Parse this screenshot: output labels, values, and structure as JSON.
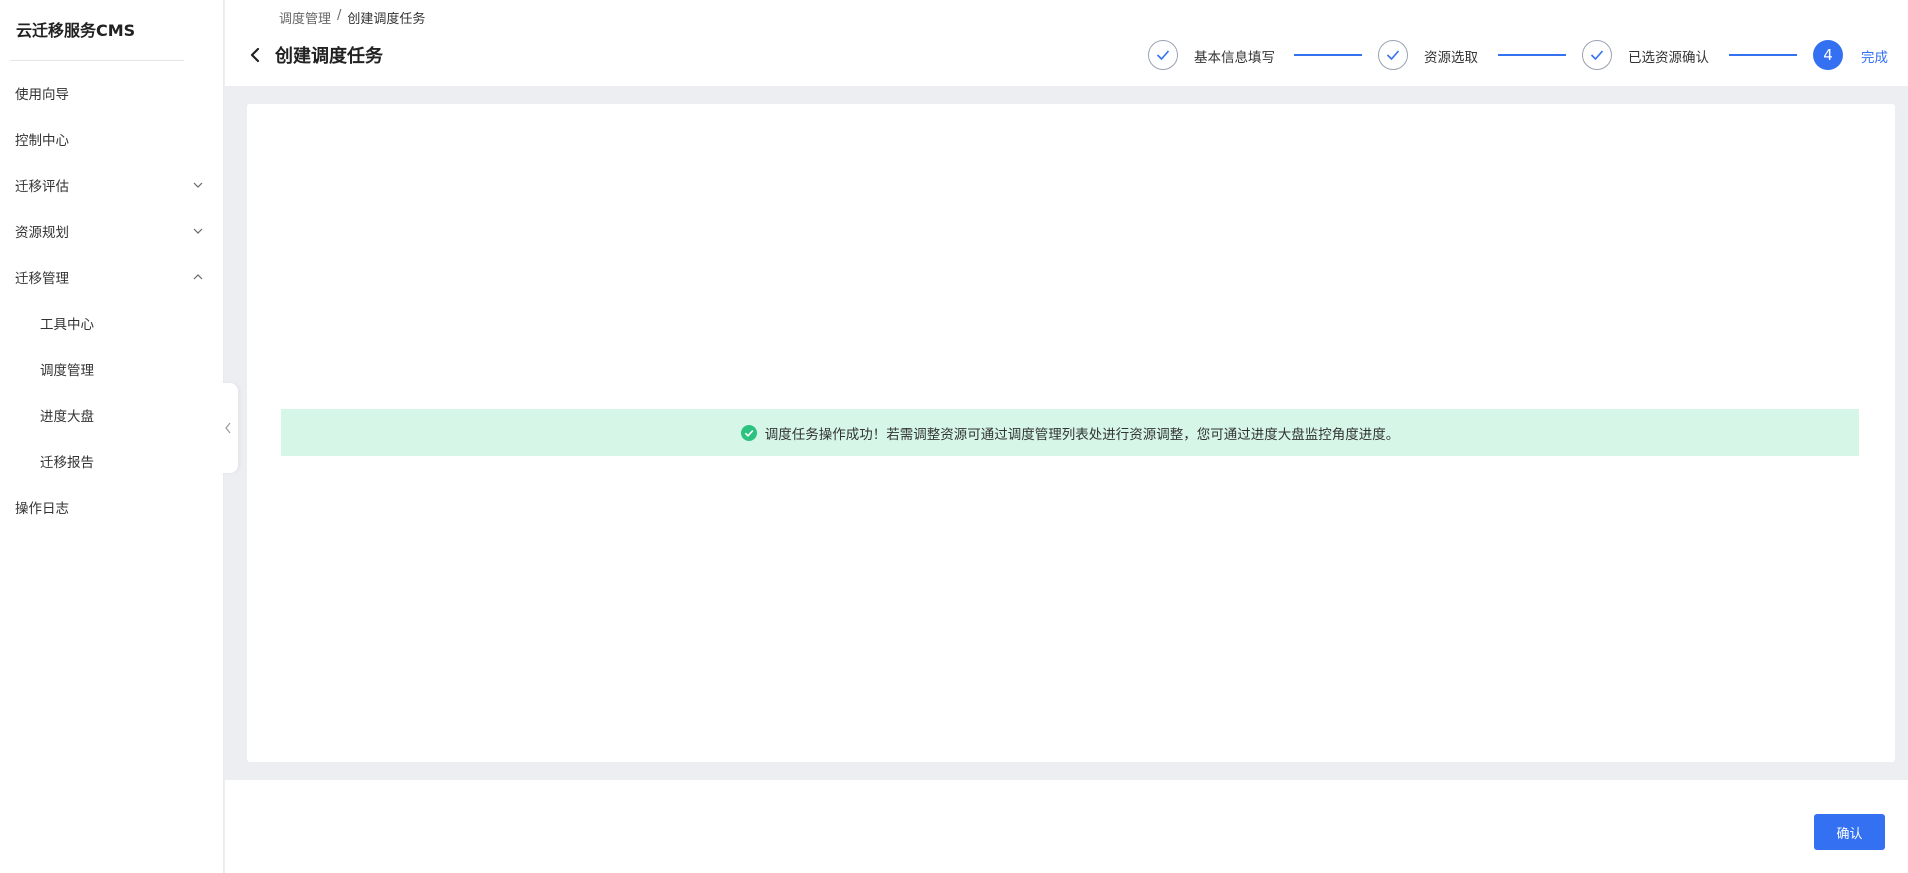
{
  "sidebar": {
    "brand": "云迁移服务CMS",
    "items": [
      {
        "label": "使用向导"
      },
      {
        "label": "控制中心"
      },
      {
        "label": "迁移评估"
      },
      {
        "label": "资源规划"
      },
      {
        "label": "迁移管理"
      },
      {
        "label": "工具中心"
      },
      {
        "label": "调度管理"
      },
      {
        "label": "进度大盘"
      },
      {
        "label": "迁移报告"
      },
      {
        "label": "操作日志"
      }
    ]
  },
  "header": {
    "breadcrumb": {
      "parent": "调度管理",
      "separator": "/",
      "current": "创建调度任务"
    },
    "title": "创建调度任务"
  },
  "steps": [
    {
      "label": "基本信息填写",
      "status": "done"
    },
    {
      "label": "资源选取",
      "status": "done"
    },
    {
      "label": "已选资源确认",
      "status": "done"
    },
    {
      "number": "4",
      "label": "完成",
      "status": "active"
    }
  ],
  "alert": {
    "message": "调度任务操作成功！若需调整资源可通过调度管理列表处进行资源调整，您可通过进度大盘监控角度进度。",
    "color": "#d6f7e7",
    "icon": "check-circle-icon"
  },
  "footer": {
    "confirm_label": "确认"
  },
  "colors": {
    "accent": "#3370f2",
    "success": "#2cc27f"
  }
}
